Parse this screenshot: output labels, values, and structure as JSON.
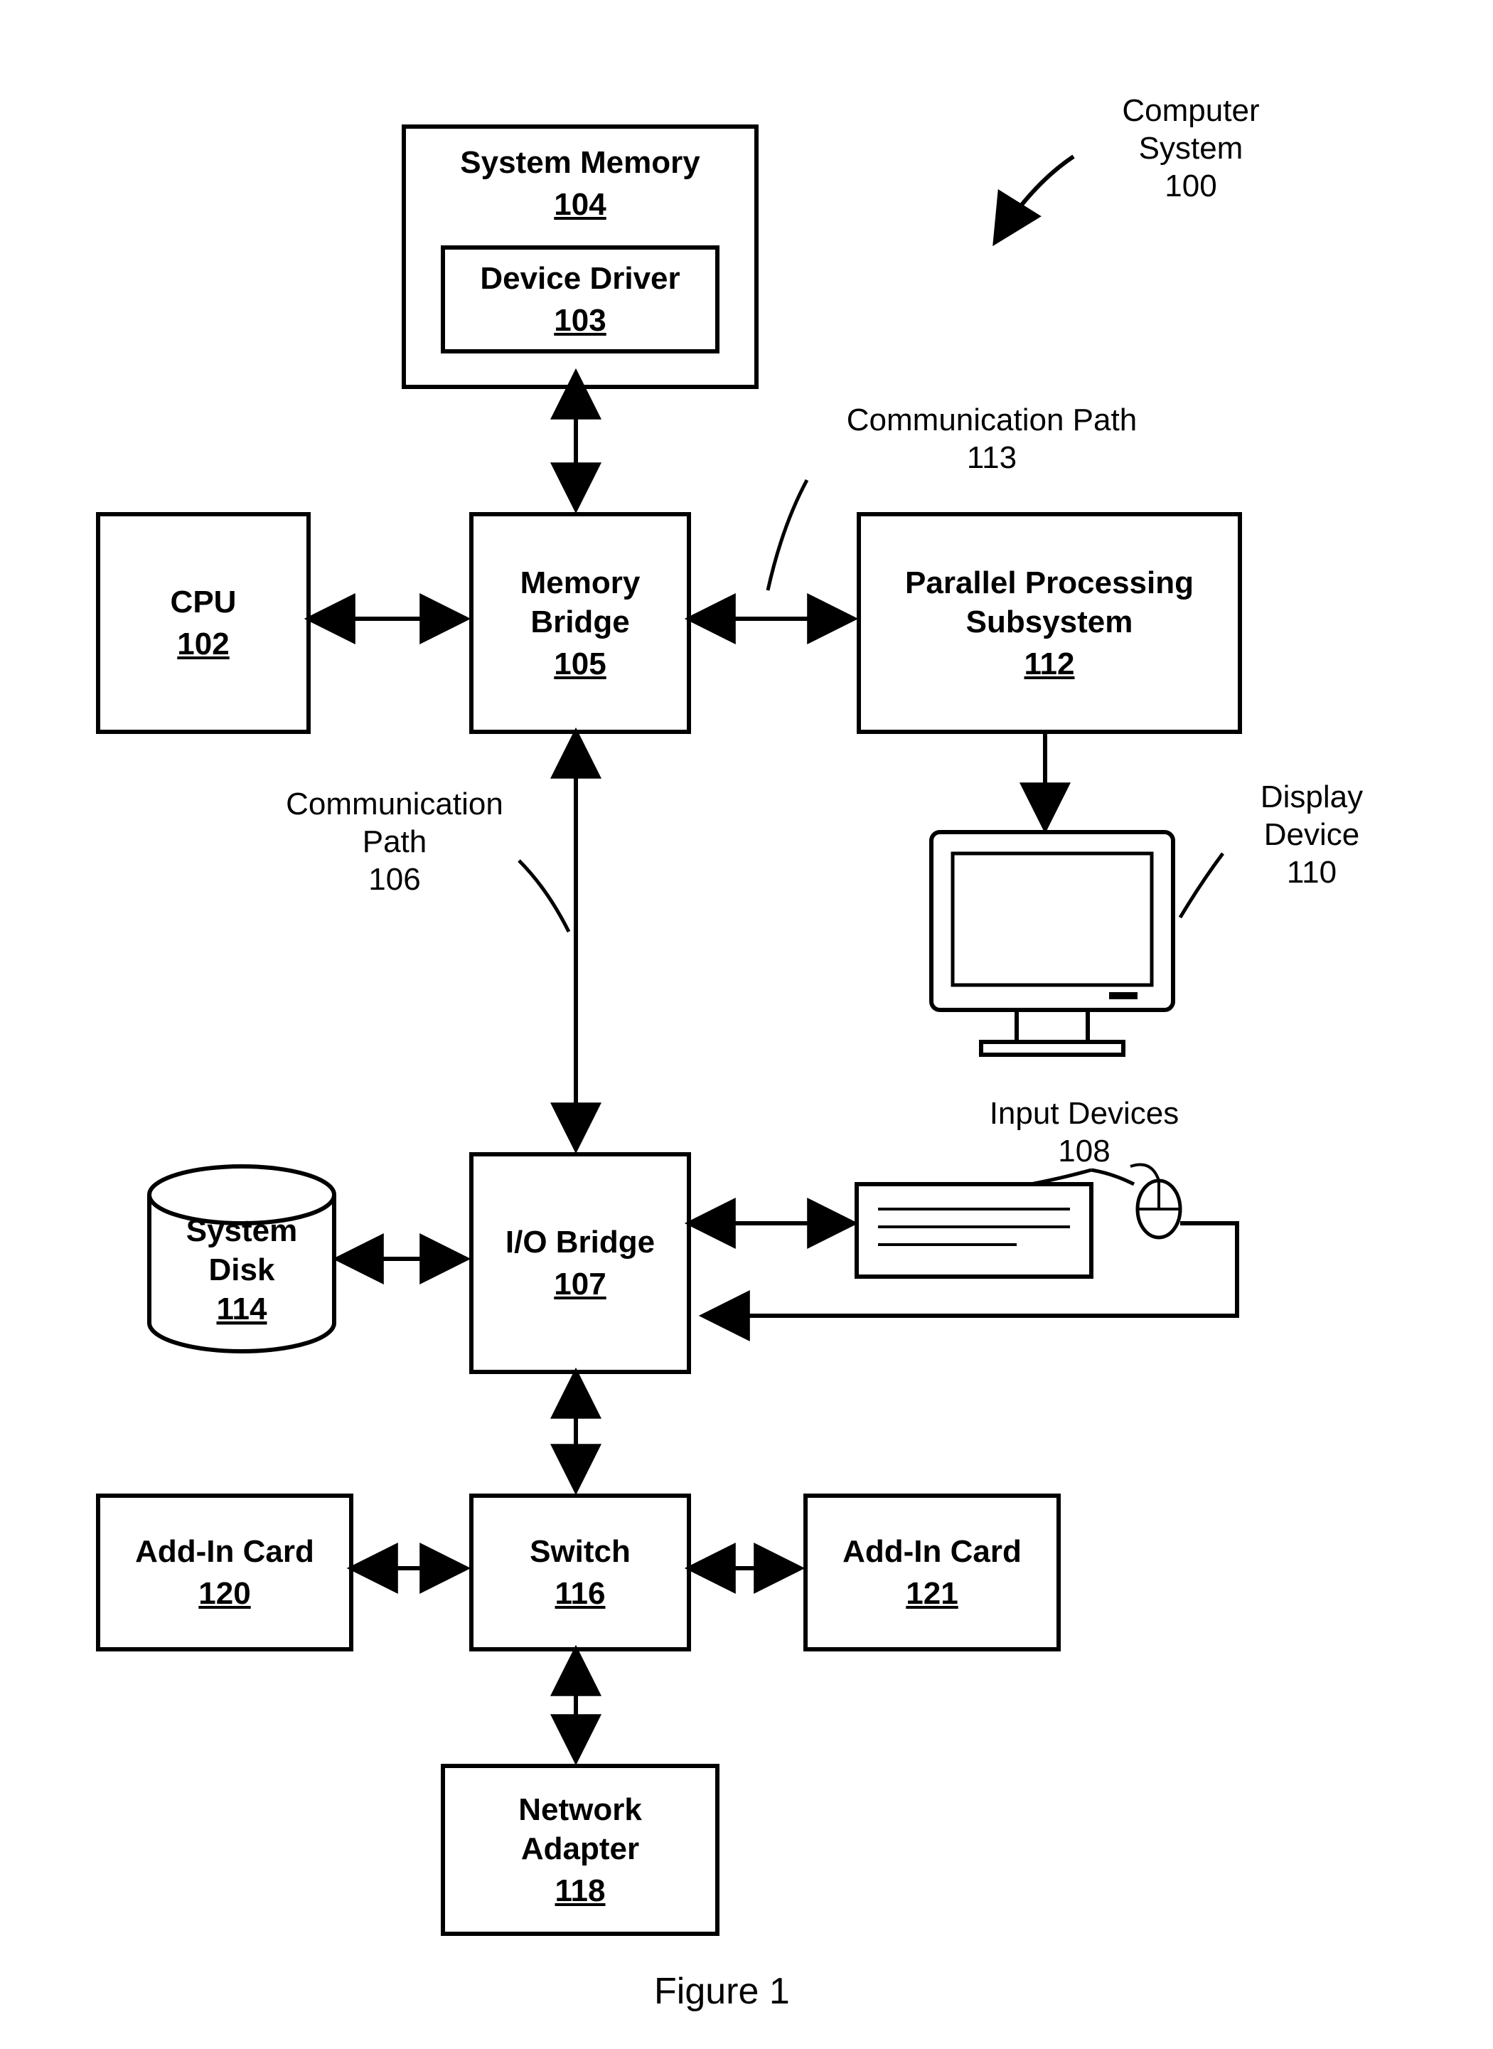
{
  "figure_caption": "Figure 1",
  "labels": {
    "computer_system": "Computer\nSystem\n100",
    "comm_path_113": "Communication Path\n113",
    "comm_path_106": "Communication\nPath\n106",
    "display_device": "Display\nDevice\n110",
    "input_devices": "Input Devices\n108"
  },
  "boxes": {
    "system_memory": {
      "title": "System Memory",
      "ref": "104"
    },
    "device_driver": {
      "title": "Device Driver",
      "ref": "103"
    },
    "cpu": {
      "title": "CPU",
      "ref": "102"
    },
    "memory_bridge": {
      "title": "Memory\nBridge",
      "ref": "105"
    },
    "pps": {
      "title": "Parallel Processing\nSubsystem",
      "ref": "112"
    },
    "io_bridge": {
      "title": "I/O Bridge",
      "ref": "107"
    },
    "system_disk": {
      "title": "System\nDisk",
      "ref": "114"
    },
    "switch": {
      "title": "Switch",
      "ref": "116"
    },
    "addin_120": {
      "title": "Add-In Card",
      "ref": "120"
    },
    "addin_121": {
      "title": "Add-In Card",
      "ref": "121"
    },
    "network_adapter": {
      "title": "Network\nAdapter",
      "ref": "118"
    }
  }
}
